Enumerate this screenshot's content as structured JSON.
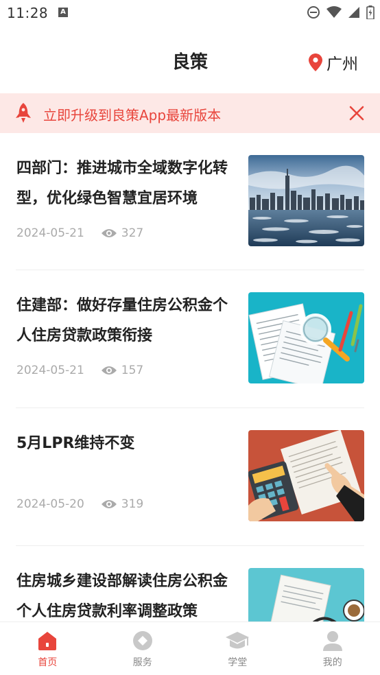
{
  "status_bar": {
    "time": "11:28",
    "notification_glyph": "A"
  },
  "header": {
    "title": "良策",
    "city": "广州"
  },
  "banner": {
    "text": "立即升级到良策App最新版本"
  },
  "news": [
    {
      "title": "四部门：推进城市全域数字化转型，优化绿色智慧宜居环境",
      "date": "2024-05-21",
      "views": "327",
      "thumb": "city-skyline"
    },
    {
      "title": "住建部：做好存量住房公积金个人住房贷款政策衔接",
      "date": "2024-05-21",
      "views": "157",
      "thumb": "documents-magnifier"
    },
    {
      "title": "5月LPR维持不变",
      "date": "2024-05-20",
      "views": "319",
      "thumb": "calculator-hand"
    },
    {
      "title": "住房城乡建设部解读住房公积金个人住房贷款利率调整政策",
      "date": "",
      "views": "",
      "thumb": "papers-coffee"
    }
  ],
  "tabs": [
    {
      "label": "首页",
      "icon": "home-icon",
      "active": true
    },
    {
      "label": "服务",
      "icon": "service-icon",
      "active": false
    },
    {
      "label": "学堂",
      "icon": "graduation-cap-icon",
      "active": false
    },
    {
      "label": "我的",
      "icon": "user-icon",
      "active": false
    }
  ],
  "colors": {
    "accent": "#e8453c",
    "banner_bg": "#fde8e6",
    "inactive_icon": "#c8c8c8"
  }
}
